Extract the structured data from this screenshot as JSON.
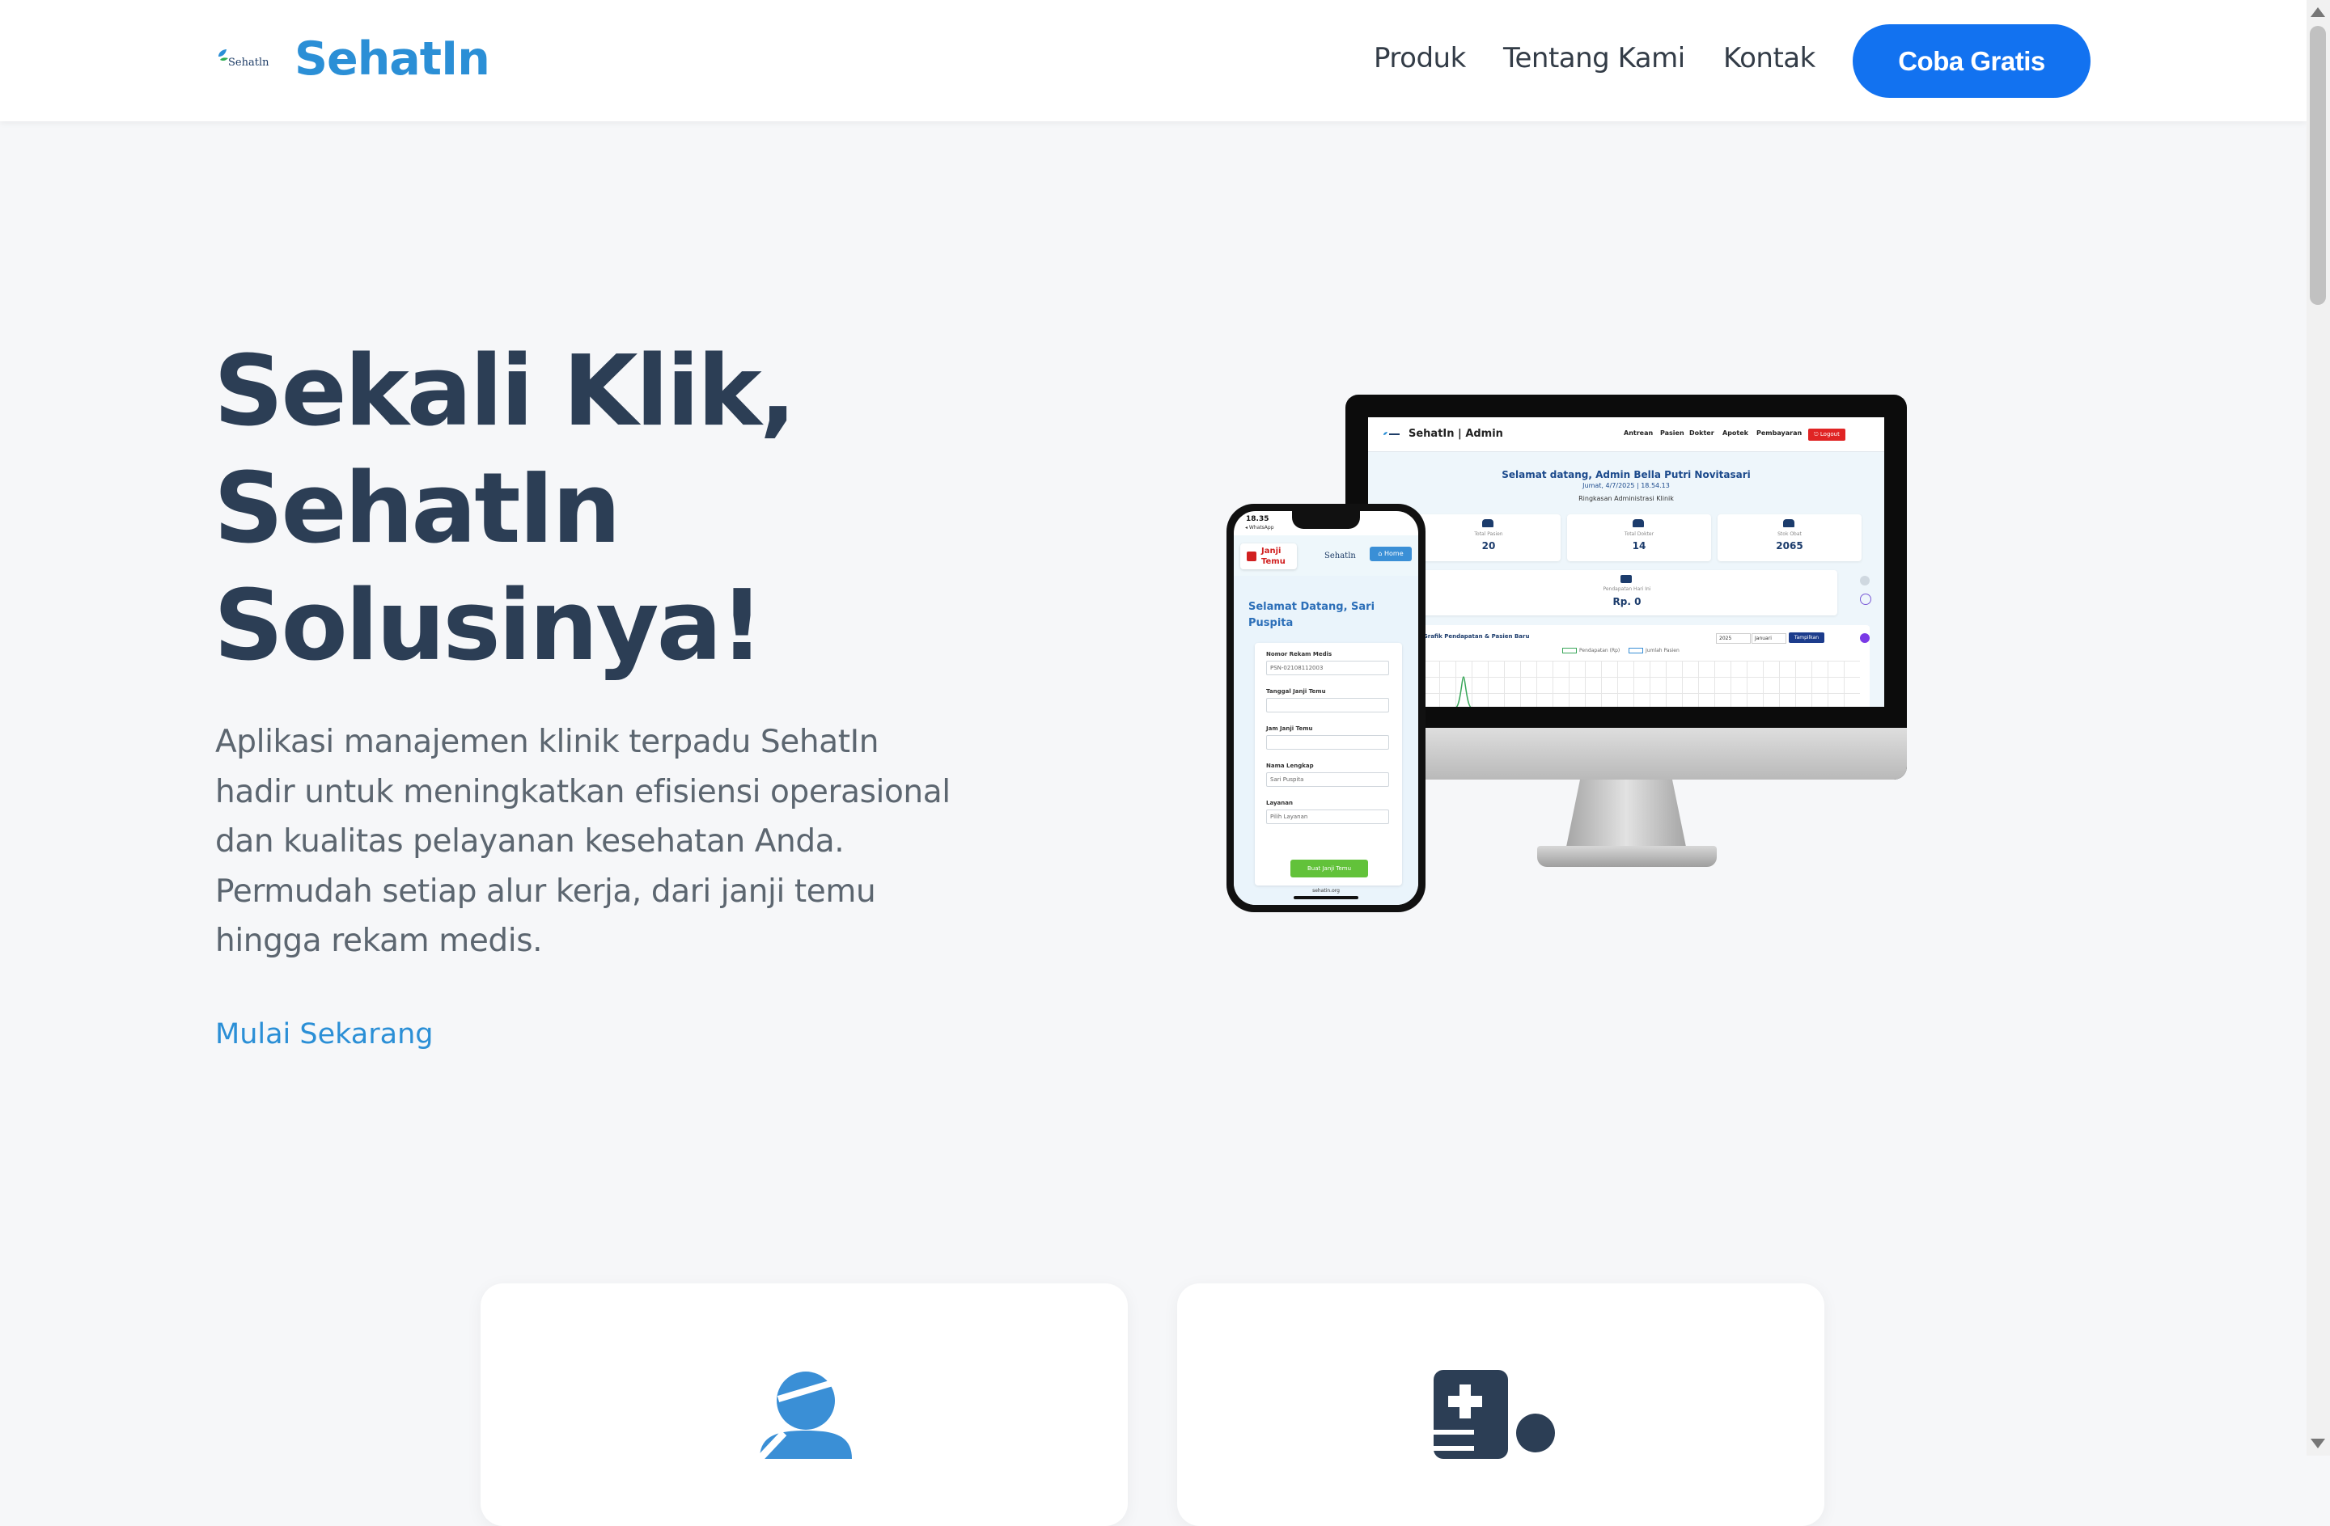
{
  "header": {
    "logo_small_text": "Sehatln",
    "brand": "SehatIn",
    "nav": [
      "Produk",
      "Tentang Kami",
      "Kontak"
    ],
    "cta_label": "Coba Gratis"
  },
  "hero": {
    "title_lines": [
      "Sekali Klik,",
      "SehatIn",
      "Solusinya!"
    ],
    "description_lines": [
      "Aplikasi manajemen klinik terpadu SehatIn",
      "hadir untuk meningkatkan efisiensi operasional",
      "dan kualitas pelayanan kesehatan Anda.",
      "Permudah setiap alur kerja, dari janji temu",
      "hingga rekam medis."
    ],
    "link_label": "Mulai Sekarang"
  },
  "monitor_screen": {
    "title": "SehatIn | Admin",
    "nav": [
      "Antrean",
      "Pasien",
      "Dokter",
      "Apotek",
      "Pembayaran"
    ],
    "logout": "⎋ Logout",
    "welcome": "Selamat datang, Admin Bella Putri Novitasari",
    "date": "Jumat, 4/7/2025 | 18.54.13",
    "subtitle": "Ringkasan Administrasi Klinik",
    "stats": [
      {
        "label": "Total Pasien",
        "value": "20"
      },
      {
        "label": "Total Dokter",
        "value": "14"
      },
      {
        "label": "Stok Obat",
        "value": "2065"
      }
    ],
    "revenue": {
      "label": "Pendapatan Hari Ini",
      "value": "Rp. 0"
    },
    "chart": {
      "title": "Grafik Pendapatan & Pasien Baru",
      "year": "2025",
      "month": "Januari",
      "button": "Tampilkan",
      "legend": [
        "Pendapatan (Rp)",
        "Jumlah Pasien"
      ]
    }
  },
  "phone_screen": {
    "time": "18.35",
    "app": "◂ WhatsApp",
    "appointment_label": "Janji Temu",
    "logo": "Sehatln",
    "home_button": "⌂ Home",
    "welcome": "Selamat Datang, Sari Puspita",
    "form": [
      {
        "label": "Nomor Rekam Medis",
        "value": "PSN-02108112003"
      },
      {
        "label": "Tanggal Janji Temu",
        "value": ""
      },
      {
        "label": "Jam Janji Temu",
        "value": ""
      },
      {
        "label": "Nama Lengkap",
        "value": "Sari Puspita"
      },
      {
        "label": "Layanan",
        "value": "Pilih Layanan"
      }
    ],
    "submit": "Buat Janji Temu",
    "url": "sehatin.org"
  },
  "colors": {
    "brand_blue": "#2b8fd6",
    "cta_blue": "#1272f0",
    "heading": "#2c3e55",
    "body_text": "#5c6670",
    "page_bg": "#f6f7f9"
  },
  "feature_icons": [
    "doctor-icon",
    "patient-record-icon"
  ]
}
